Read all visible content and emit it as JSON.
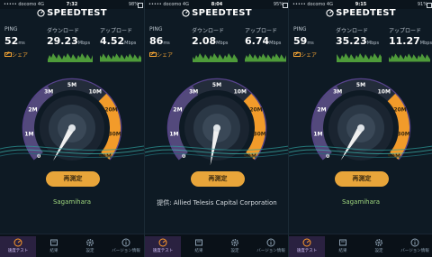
{
  "app": {
    "logo": "SPEEDTEST",
    "share_label": "シェア",
    "retest_label": "再測定",
    "ping_label": "PING",
    "ping_unit": "ms",
    "download_label": "ダウンロード",
    "upload_label": "アップロード",
    "speed_unit": "Mbps"
  },
  "gauge": {
    "ticks": [
      "0",
      "1M",
      "2M",
      "3M",
      "5M",
      "10M",
      "20M",
      "30M",
      "50M"
    ],
    "colors": {
      "arc": "#f29b2a",
      "track": "#8f6ccf",
      "needle": "#f0f0f0"
    }
  },
  "tabs": [
    {
      "label": "速度テスト",
      "icon": "speedometer-icon"
    },
    {
      "label": "結果",
      "icon": "results-icon"
    },
    {
      "label": "設定",
      "icon": "gear-icon"
    },
    {
      "label": "バージョン情報",
      "icon": "info-icon"
    }
  ],
  "screens": [
    {
      "status": {
        "carrier": "docomo",
        "network": "4G",
        "time": "7:32",
        "battery": "98%"
      },
      "ping": "52",
      "download": "29.23",
      "upload": "4.52",
      "needle_value": "4.3M",
      "location": "Sagamihara"
    },
    {
      "status": {
        "carrier": "docomo",
        "network": "4G",
        "time": "8:04",
        "battery": "95%"
      },
      "ping": "86",
      "download": "2.08",
      "upload": "6.74",
      "needle_value": "0.6M",
      "location": "提供: Allied Telesis Capital Corporation"
    },
    {
      "status": {
        "carrier": "docomo",
        "network": "4G",
        "time": "9:15",
        "battery": "91%"
      },
      "ping": "59",
      "download": "35.23",
      "upload": "11.27",
      "needle_value": "4.7M",
      "location": "Sagamihara"
    }
  ]
}
